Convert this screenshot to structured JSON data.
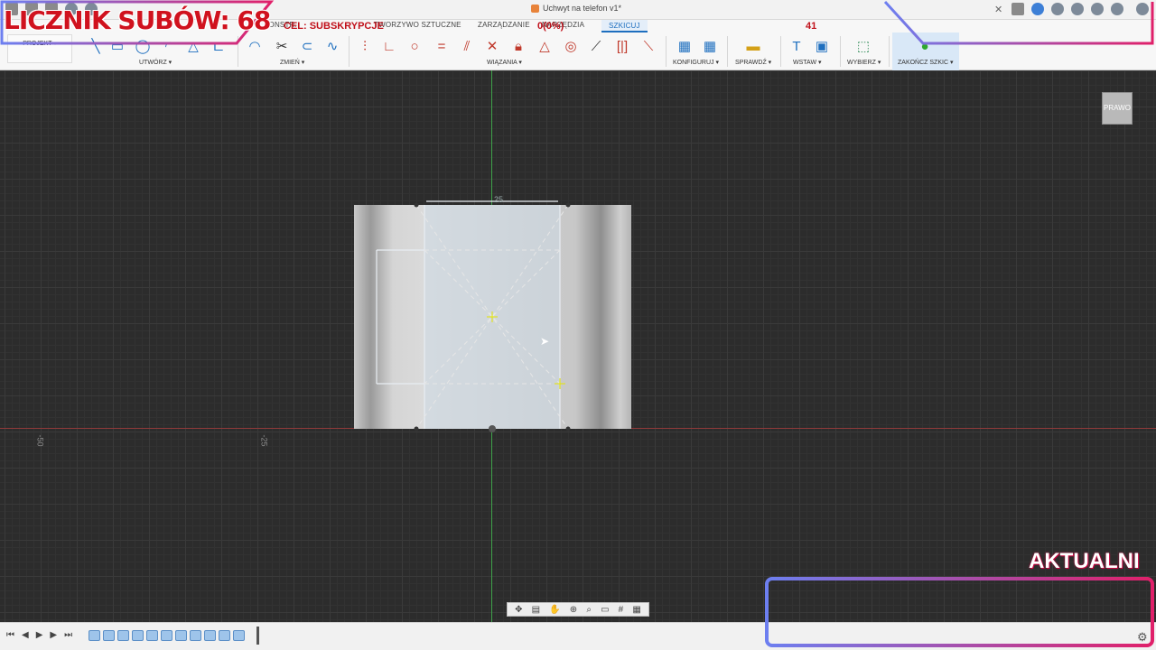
{
  "window": {
    "doc_title": "Uchwyt na telefon v1*"
  },
  "tabs": [
    {
      "label": "KONSTR."
    },
    {
      "label": "TWORZYWO SZTUCZNE"
    },
    {
      "label": "ZARZĄDZANIE"
    },
    {
      "label": "NARZĘDZIA"
    },
    {
      "label": "SZKICUJ"
    }
  ],
  "projekt": {
    "label": "PROJEKT ▾"
  },
  "ribbon": {
    "groups": {
      "create": "UTWÓRZ ▾",
      "modify": "ZMIEŃ ▾",
      "constraints": "WIĄZANIA ▾",
      "configure": "KONFIGURUJ ▾",
      "inspect": "SPRAWDŹ ▾",
      "insert": "WSTAW ▾",
      "select": "WYBIERZ ▾",
      "finish": "ZAKOŃCZ SZKIC ▾"
    },
    "accent": "#1e6fbf"
  },
  "canvas": {
    "dimension_label": "25",
    "ruler_labels": [
      "-50",
      "-25"
    ],
    "viewcube_label": "PRAWO",
    "axis_colors": {
      "vertical": "#3fa34a",
      "horizontal": "#8f3a3a"
    }
  },
  "overlays": {
    "sub_counter": "LICZNIK SUBÓW: 68",
    "goal": "CEL: SUBSKRYPCJE",
    "goal_pct": "0(0%)",
    "goal_count": "41",
    "aktualni": "AKTUALNI",
    "colors": {
      "counter": "#d0121e",
      "frame_a": "#6d7ff0",
      "frame_b": "#e0206a"
    }
  },
  "icons": [
    "file-icon",
    "save-icon",
    "undo-icon",
    "redo-icon",
    "line-icon",
    "rectangle-icon",
    "circle-icon",
    "arc-icon",
    "polygon-icon",
    "fillet-icon",
    "trim-icon",
    "offset-icon",
    "spline-icon",
    "coincident-icon",
    "perpendicular-icon",
    "tangent-icon",
    "equal-icon",
    "parallel-icon",
    "horizontal-vertical-icon",
    "lock-icon",
    "triangle-icon",
    "concentric-icon",
    "midpoint-icon",
    "symmetry-icon",
    "curvature-icon",
    "configure-icon",
    "measure-icon",
    "insert-text-icon",
    "insert-image-icon",
    "select-icon",
    "finish-sketch-icon"
  ]
}
